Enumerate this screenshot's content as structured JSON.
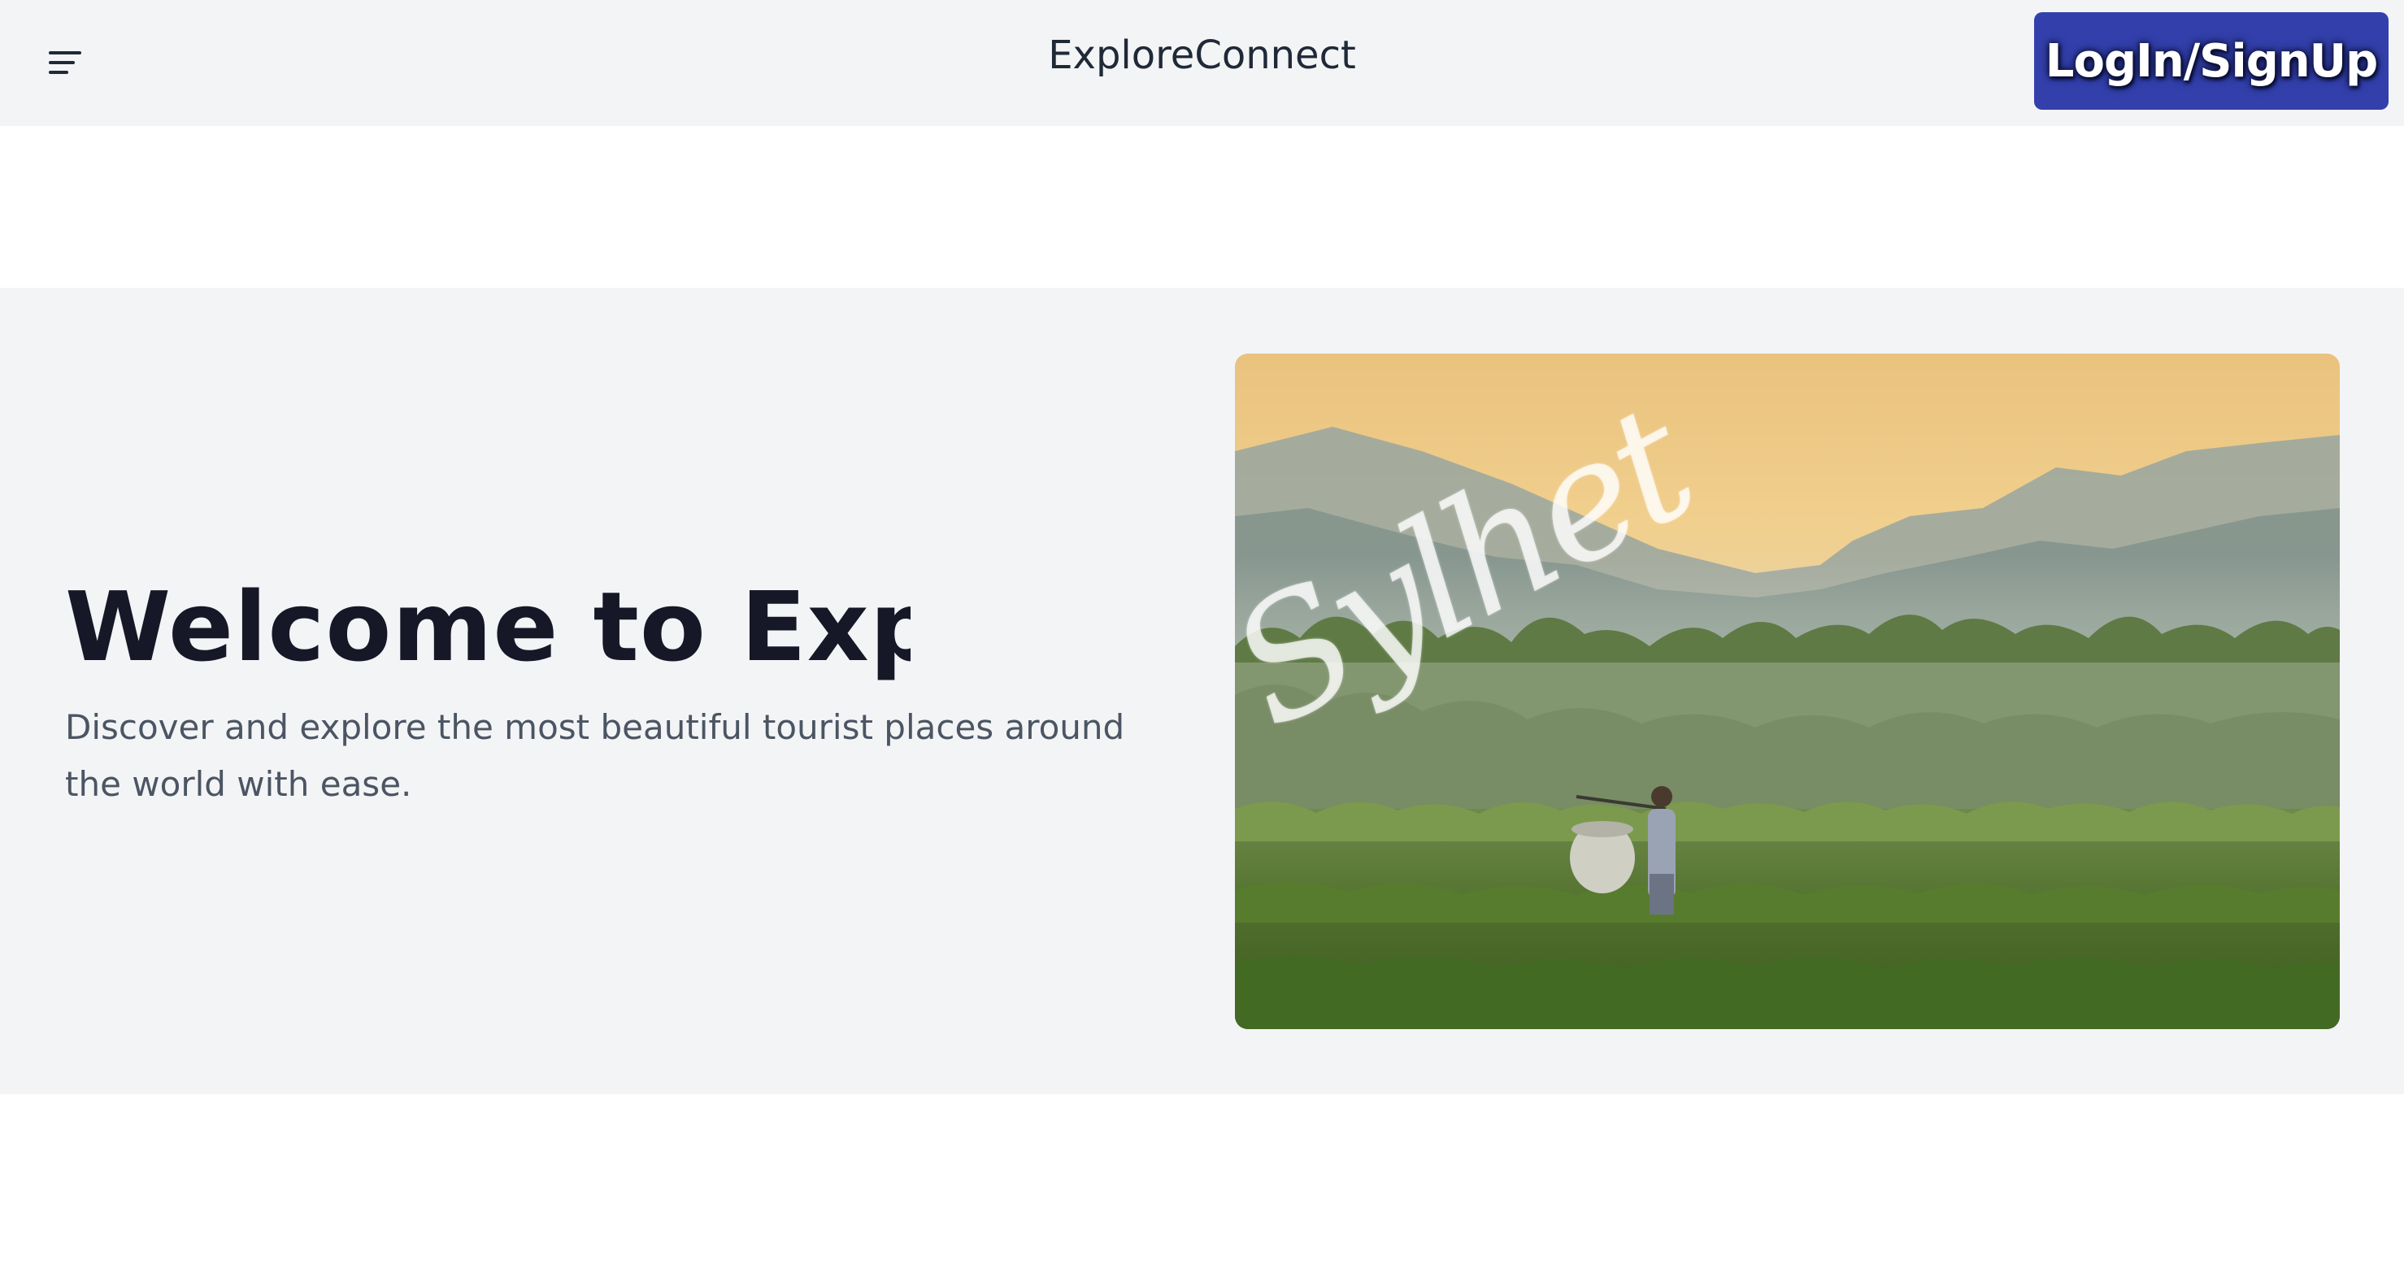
{
  "header": {
    "menu_icon": "hamburger-icon",
    "brand": "ExploreConnect",
    "login_label": "LogIn/SignUp"
  },
  "hero": {
    "title": "Welcome to Explor",
    "subtitle": "Discover and explore the most beautiful tourist places around the world with ease.",
    "image": {
      "description_label": "Sylhet",
      "alt": "Sylhet"
    }
  },
  "colors": {
    "header_bg": "#f3f4f6",
    "button_bg": "#3340ac",
    "title": "#161827",
    "subtitle": "#4b5563"
  }
}
